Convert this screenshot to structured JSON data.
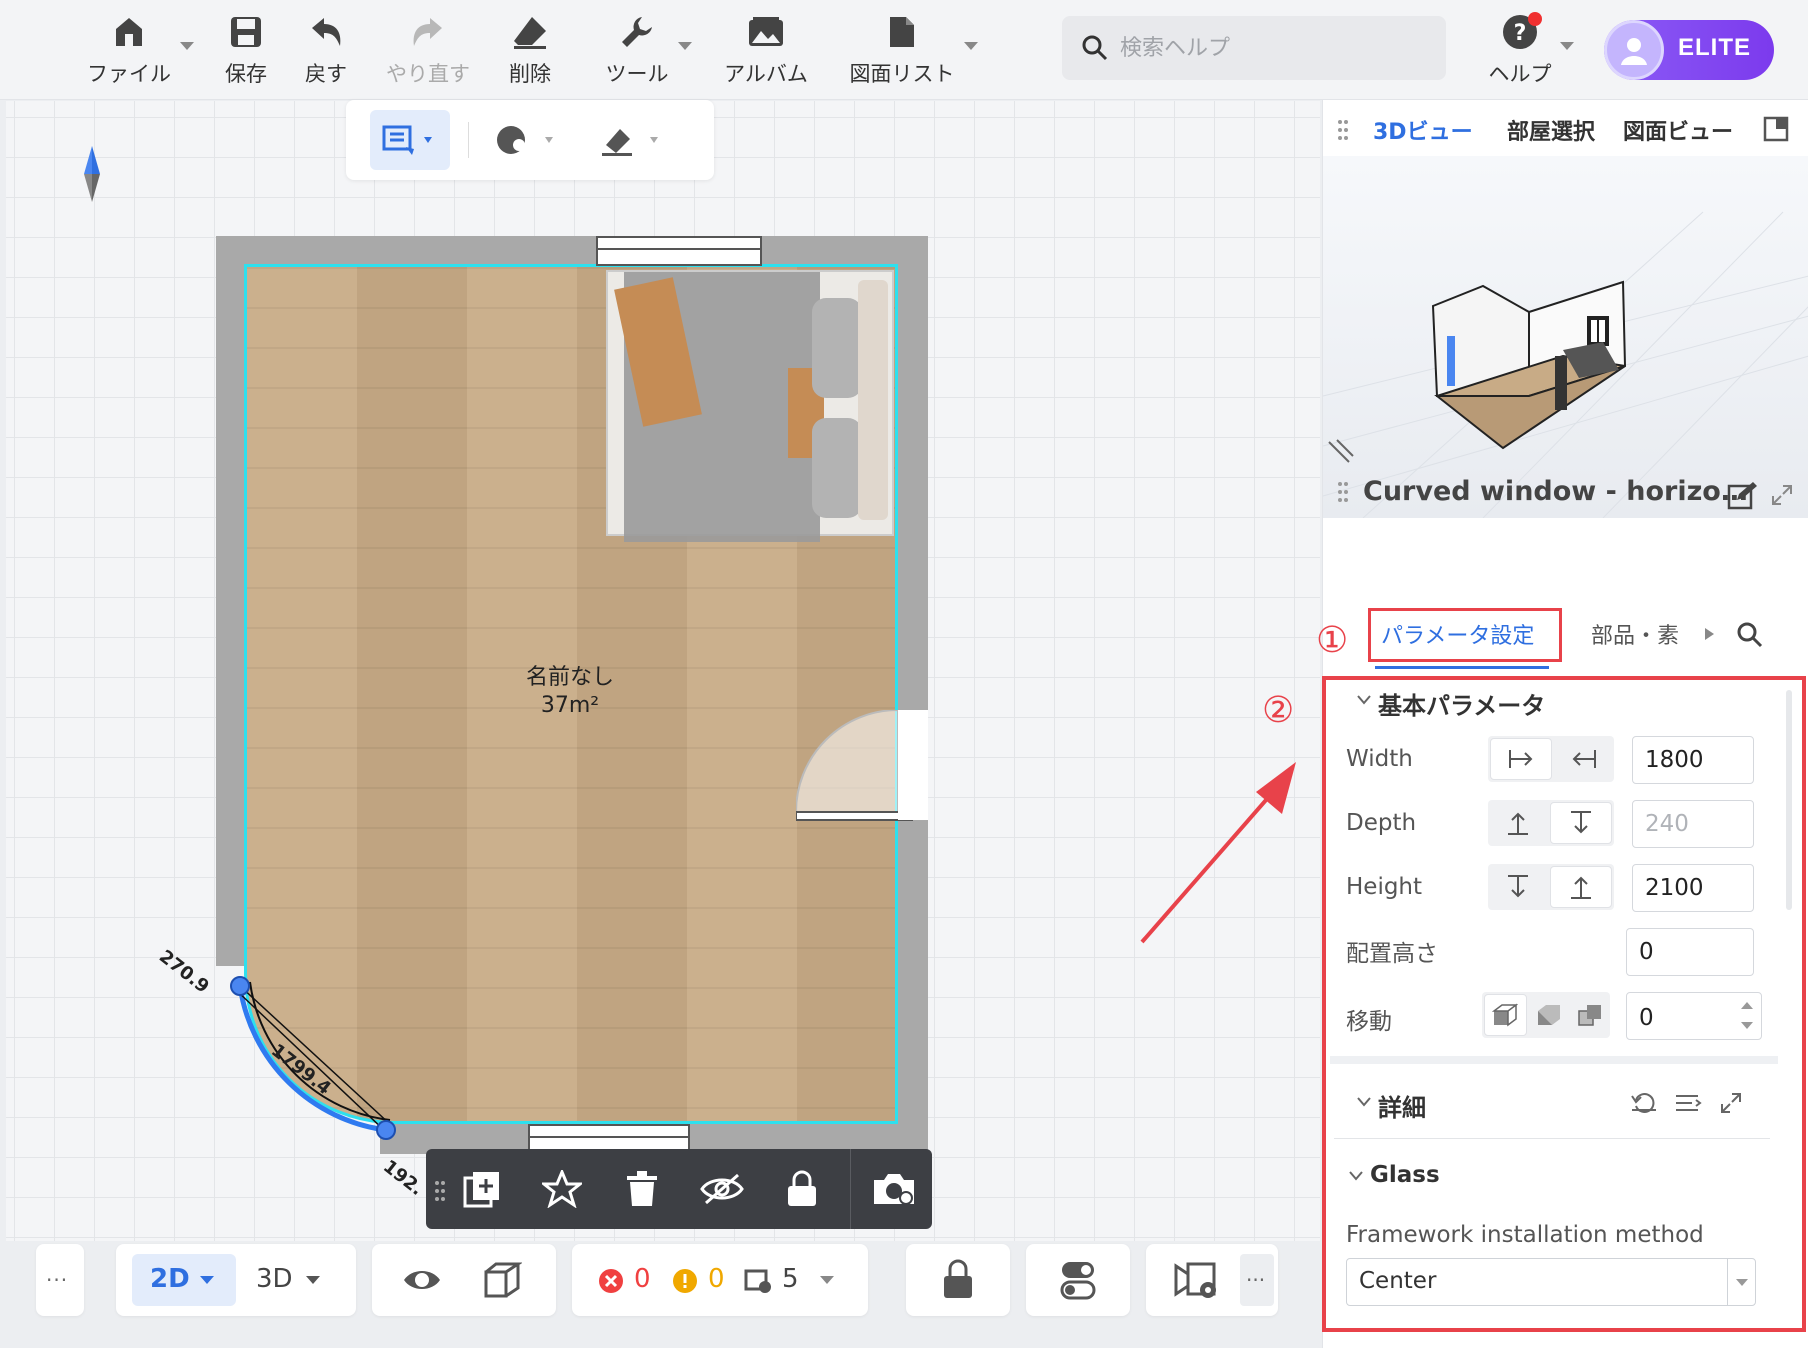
{
  "toolbar": {
    "file": "ファイル",
    "save": "保存",
    "undo": "戻す",
    "redo": "やり直す",
    "delete": "削除",
    "tools": "ツール",
    "album": "アルバム",
    "drawing_list": "図面リスト"
  },
  "search": {
    "placeholder": "検索ヘルプ"
  },
  "help": {
    "label": "ヘルプ"
  },
  "user": {
    "badge": "ELITE"
  },
  "canvas": {
    "room_name": "名前なし",
    "room_area": "37m²",
    "dim_a": "270.9",
    "dim_b": "1799.4",
    "dim_c": "192."
  },
  "statusbar": {
    "view_2d": "2D",
    "view_3d": "3D",
    "errors": "0",
    "warnings": "0",
    "items": "5"
  },
  "right_panel": {
    "tabs": [
      "3Dビュー",
      "部屋選択",
      "図面ビュー"
    ],
    "object_title": "Curved window - horizo…",
    "param_tab": "パラメータ設定",
    "parts_tab": "部品・素",
    "step1": "①",
    "step2": "②",
    "basic_section": "基本パラメータ",
    "width_label": "Width",
    "width_value": "1800",
    "depth_label": "Depth",
    "depth_value": "240",
    "height_label": "Height",
    "height_value": "2100",
    "elevation_label": "配置高さ",
    "elevation_value": "0",
    "move_label": "移動",
    "move_value": "0",
    "detail_section": "詳細",
    "glass_section": "Glass",
    "framework_label": "Framework installation method",
    "framework_value": "Center"
  }
}
